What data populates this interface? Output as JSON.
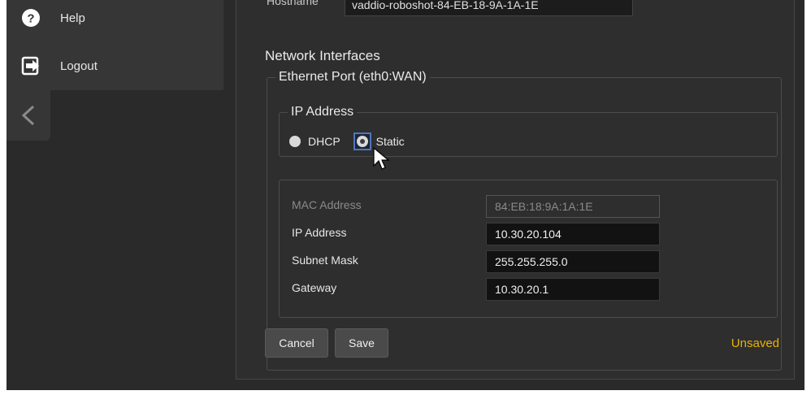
{
  "sidebar": {
    "items": [
      {
        "label": "Help",
        "icon": "help-icon"
      },
      {
        "label": "Logout",
        "icon": "logout-icon"
      }
    ],
    "collapse_icon": "chevron-left-icon"
  },
  "hostname": {
    "label": "Hostname",
    "value": "vaddio-roboshot-84-EB-18-9A-1A-1E"
  },
  "network": {
    "title": "Network Interfaces",
    "ethernet_legend": "Ethernet Port (eth0:WAN)",
    "ip_legend": "IP Address",
    "mode_options": [
      "DHCP",
      "Static"
    ],
    "selected_mode": "Static",
    "fields": [
      {
        "label": "MAC Address",
        "value": "84:EB:18:9A:1A:1E",
        "disabled": true
      },
      {
        "label": "IP Address",
        "value": "10.30.20.104",
        "disabled": false
      },
      {
        "label": "Subnet Mask",
        "value": "255.255.255.0",
        "disabled": false
      },
      {
        "label": "Gateway",
        "value": "10.30.20.1",
        "disabled": false
      }
    ]
  },
  "actions": {
    "cancel_label": "Cancel",
    "save_label": "Save",
    "status_text": "Unsaved"
  },
  "colors": {
    "background": "#2a2a2a",
    "sidebar": "#363636",
    "status_warning": "#e8b400",
    "focus_ring": "#4f77b8"
  }
}
